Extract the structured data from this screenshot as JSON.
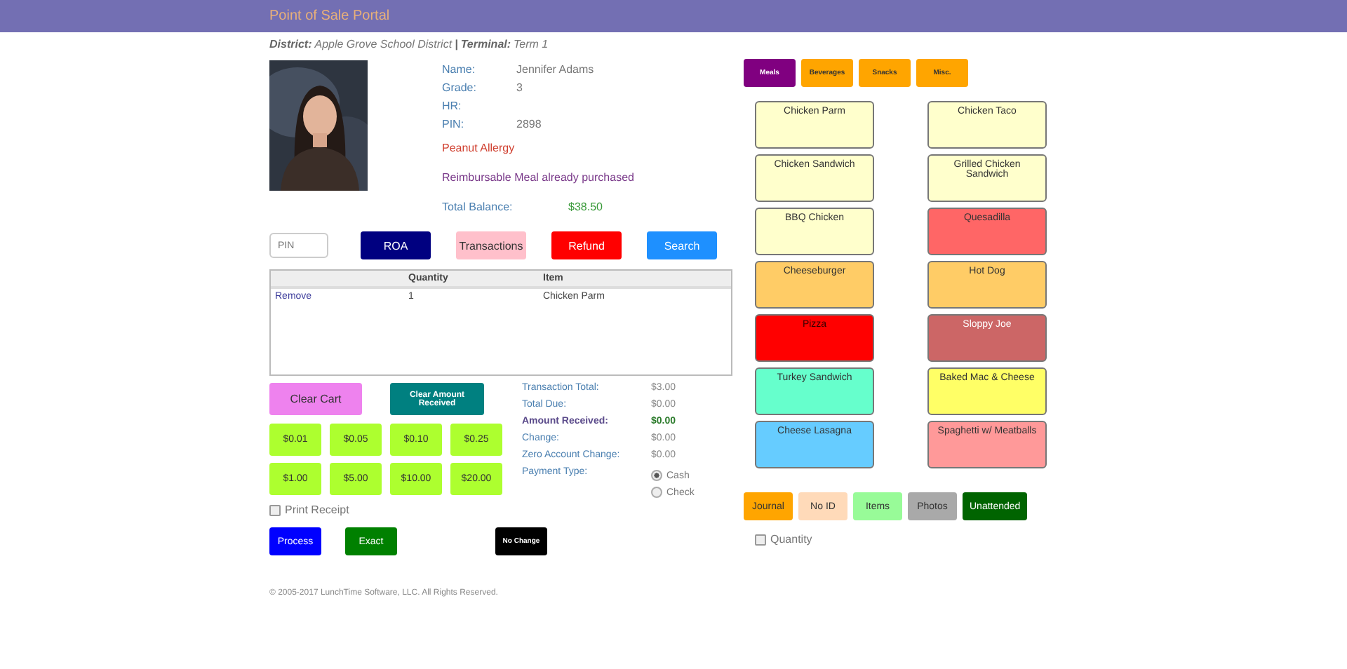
{
  "header": {
    "title": "Point of Sale Portal"
  },
  "context": {
    "district_label": "District:",
    "district": "Apple Grove School District",
    "separator": "|",
    "terminal_label": "Terminal:",
    "terminal": "Term 1"
  },
  "student": {
    "fields": [
      {
        "label": "Name:",
        "value": "Jennifer Adams"
      },
      {
        "label": "Grade:",
        "value": "3"
      },
      {
        "label": "HR:"
      },
      {
        "label": "PIN:",
        "value": "2898"
      }
    ],
    "alert": "Peanut Allergy",
    "notice": "Reimbursable Meal already purchased",
    "balance_label": "Total Balance:",
    "balance": "$38.50"
  },
  "pin_field": {
    "placeholder": "PIN"
  },
  "actions": [
    {
      "label": "ROA",
      "color": "#000080"
    },
    {
      "label": "Transactions",
      "color": "#ffc0cb"
    },
    {
      "label": "Refund",
      "color": "#ff0000"
    },
    {
      "label": "Search",
      "color": "#1e90ff"
    }
  ],
  "cart": {
    "columns": [
      "Quantity",
      "Item"
    ],
    "rows": [
      {
        "action": "Remove",
        "quantity": "1",
        "item": "Chicken Parm"
      }
    ]
  },
  "clear_buttons": [
    {
      "label": "Clear Cart",
      "kind": "cart"
    },
    {
      "label": "Clear Amount Received",
      "kind": "amount"
    }
  ],
  "denominations": [
    "$0.01",
    "$0.05",
    "$0.10",
    "$0.25",
    "$1.00",
    "$5.00",
    "$10.00",
    "$20.00"
  ],
  "totals": [
    {
      "label": "Transaction Total:",
      "value": "$3.00",
      "kind": "plain"
    },
    {
      "label": "Total Due:",
      "value": "$0.00",
      "kind": "plain"
    },
    {
      "label": "Amount Received:",
      "value": "$0.00",
      "kind": "strong"
    },
    {
      "label": "Change:",
      "value": "$0.00",
      "kind": "plain"
    },
    {
      "label": "Zero Account Change:",
      "value": "$0.00",
      "kind": "plain"
    }
  ],
  "payment_type": {
    "label": "Payment Type:",
    "options": [
      {
        "label": "Cash",
        "selected": true
      },
      {
        "label": "Check",
        "selected": false
      }
    ]
  },
  "print_receipt": {
    "label": "Print Receipt",
    "checked": false
  },
  "submit_buttons": [
    {
      "label": "Process",
      "kind": "process"
    },
    {
      "label": "Exact",
      "kind": "exact"
    },
    {
      "label": "No Change",
      "kind": "nochange"
    }
  ],
  "footer": "© 2005-2017 LunchTime Software, LLC. All Rights Reserved.",
  "categories": [
    {
      "label": "Meals",
      "selected": true
    },
    {
      "label": "Beverages",
      "selected": false
    },
    {
      "label": "Snacks",
      "selected": false
    },
    {
      "label": "Misc.",
      "selected": false
    }
  ],
  "menu_items": [
    {
      "label": "Chicken Parm",
      "color": "#ffffcc"
    },
    {
      "label": "Chicken Taco",
      "color": "#ffffcc"
    },
    {
      "label": "Chicken Sandwich",
      "color": "#ffffcc"
    },
    {
      "label": "Grilled Chicken Sandwich",
      "color": "#ffffcc"
    },
    {
      "label": "BBQ Chicken",
      "color": "#ffffcc"
    },
    {
      "label": "Quesadilla",
      "color": "#ff6666"
    },
    {
      "label": "Cheeseburger",
      "color": "#ffcc66"
    },
    {
      "label": "Hot Dog",
      "color": "#ffcc66"
    },
    {
      "label": "Pizza",
      "color": "#ff0000"
    },
    {
      "label": "Sloppy Joe",
      "color": "#cc6666"
    },
    {
      "label": "Turkey Sandwich",
      "color": "#66ffcc"
    },
    {
      "label": "Baked Mac & Cheese",
      "color": "#ffff66"
    },
    {
      "label": "Cheese Lasagna",
      "color": "#66ccff"
    },
    {
      "label": "Spaghetti w/ Meatballs",
      "color": "#ff9999"
    }
  ],
  "modes": [
    {
      "label": "Journal",
      "color": "#ffa500"
    },
    {
      "label": "No ID",
      "color": "#ffdab9"
    },
    {
      "label": "Items",
      "color": "#98fb98"
    },
    {
      "label": "Photos",
      "color": "#a9a9a9"
    },
    {
      "label": "Unattended",
      "color": "#006400"
    }
  ],
  "quantity_option": {
    "label": "Quantity",
    "checked": false
  }
}
